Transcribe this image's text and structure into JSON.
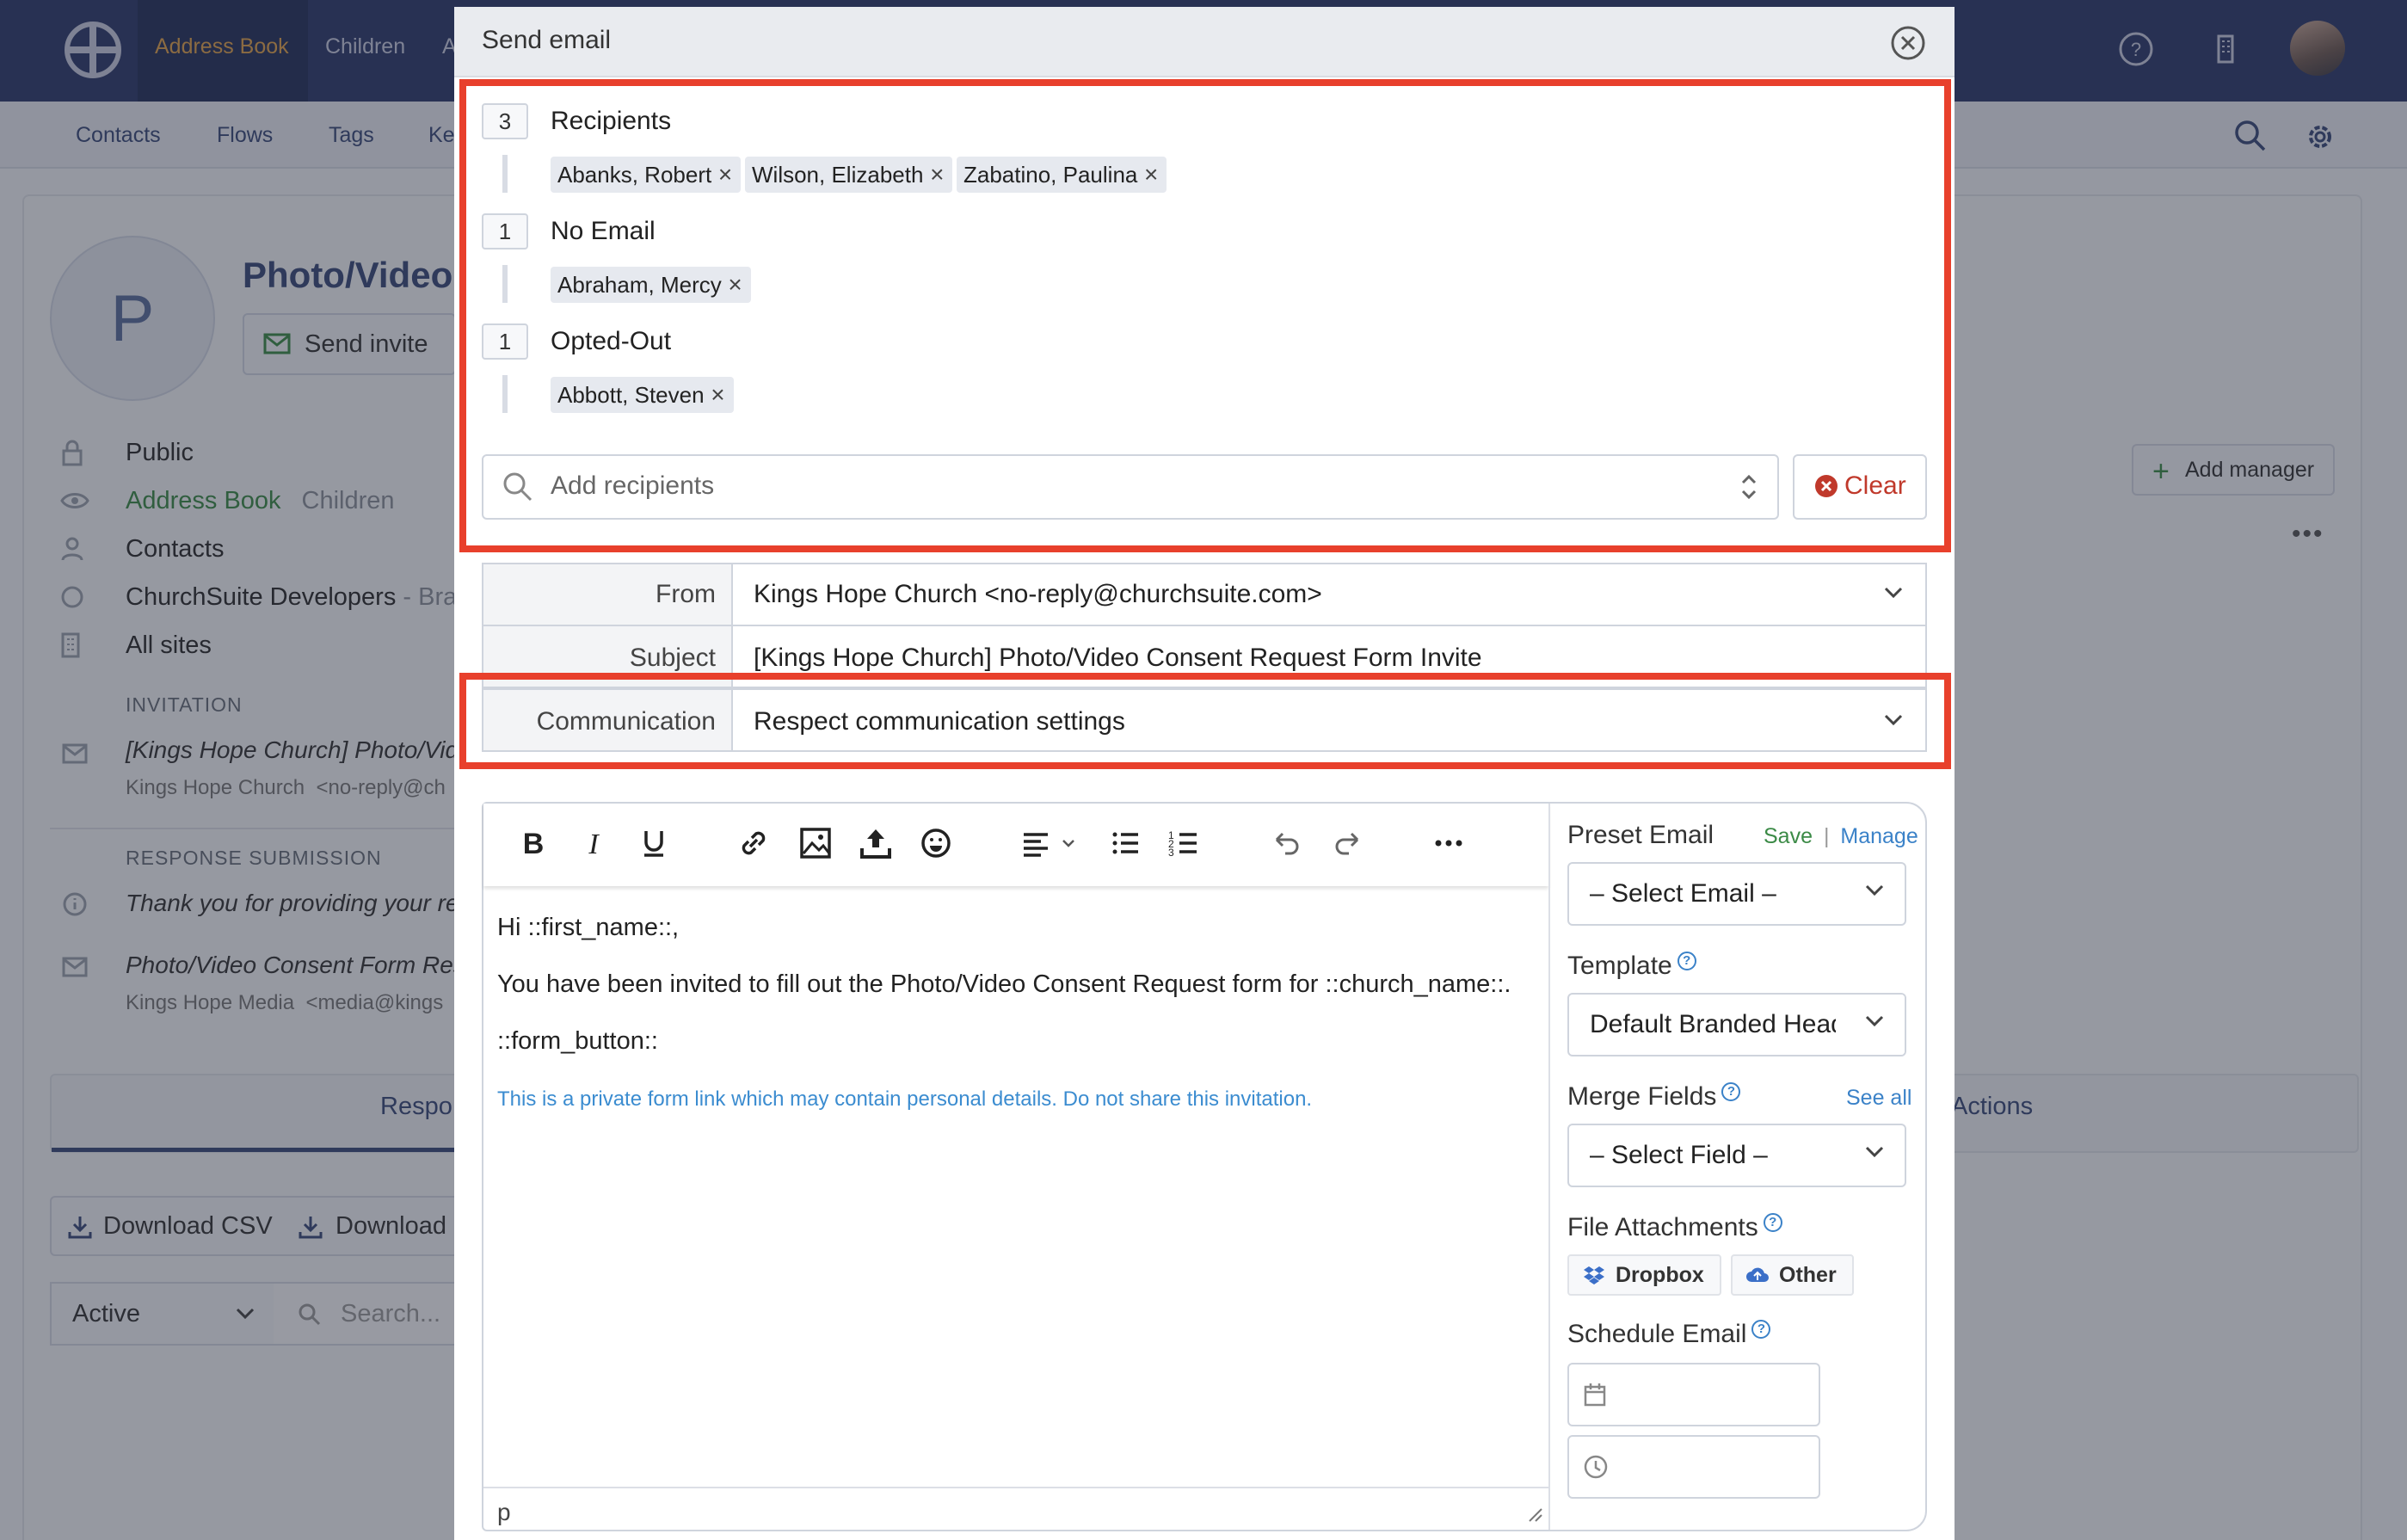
{
  "app": {
    "topnav": [
      "Address Book",
      "Children",
      "A"
    ],
    "subnav": [
      "Contacts",
      "Flows",
      "Tags",
      "Ke"
    ]
  },
  "background": {
    "avatar_letter": "P",
    "title": "Photo/Video",
    "send_invite": "Send invite",
    "sidebar": {
      "public": "Public",
      "address_book": "Address Book",
      "children": "Children",
      "contacts": "Contacts",
      "org": "ChurchSuite Developers",
      "org_suffix": " - Bra",
      "all_sites": "All sites"
    },
    "invitation_heading": "INVITATION",
    "invitation_subject": "[Kings Hope Church] Photo/Vide",
    "invitation_from": "Kings Hope Church  <no-reply@ch",
    "response_heading": "RESPONSE SUBMISSION",
    "response_text": "Thank you for providing your re",
    "consent_subject": "Photo/Video Consent Form Resp",
    "consent_from": "Kings Hope Media  <media@kings",
    "tab_responses": "Respo",
    "tab_actions": "Actions",
    "download_csv": "Download CSV",
    "download_other": "Download",
    "filter_active": "Active",
    "search_placeholder": "Search...",
    "add_manager": "Add manager"
  },
  "modal": {
    "title": "Send email",
    "groups": [
      {
        "count": "3",
        "label": "Recipients",
        "chips": [
          "Abanks, Robert",
          "Wilson, Elizabeth",
          "Zabatino, Paulina"
        ]
      },
      {
        "count": "1",
        "label": "No Email",
        "chips": [
          "Abraham, Mercy"
        ]
      },
      {
        "count": "1",
        "label": "Opted-Out",
        "chips": [
          "Abbott, Steven"
        ]
      }
    ],
    "add_recipients_placeholder": "Add recipients",
    "clear_label": "Clear",
    "from_label": "From",
    "from_value": "Kings Hope Church <no-reply@churchsuite.com>",
    "subject_label": "Subject",
    "subject_value": "[Kings Hope Church] Photo/Video Consent Request Form Invite",
    "communication_label": "Communication",
    "communication_value": "Respect communication settings",
    "editor": {
      "line1": "Hi ::first_name::,",
      "line2": "You have been invited to fill out the Photo/Video Consent Request form for ::church_name::.",
      "line3": "::form_button::",
      "note": "This is a private form link which may contain personal details. Do not share this invitation.",
      "status_path": "p"
    },
    "sidebar": {
      "preset_email_label": "Preset Email",
      "save_link": "Save",
      "separator": "|",
      "manage_link": "Manage",
      "preset_select": "– Select Email –",
      "template_label": "Template",
      "template_value": "Default Branded Head",
      "merge_fields_label": "Merge Fields",
      "see_all": "See all",
      "merge_select": "– Select Field –",
      "attachments_label": "File Attachments",
      "dropbox": "Dropbox",
      "other": "Other",
      "schedule_label": "Schedule Email"
    }
  },
  "colors": {
    "navy": "#2d3a6b",
    "highlight": "#e8402c",
    "link": "#3b82c8",
    "danger": "#c0392b"
  }
}
